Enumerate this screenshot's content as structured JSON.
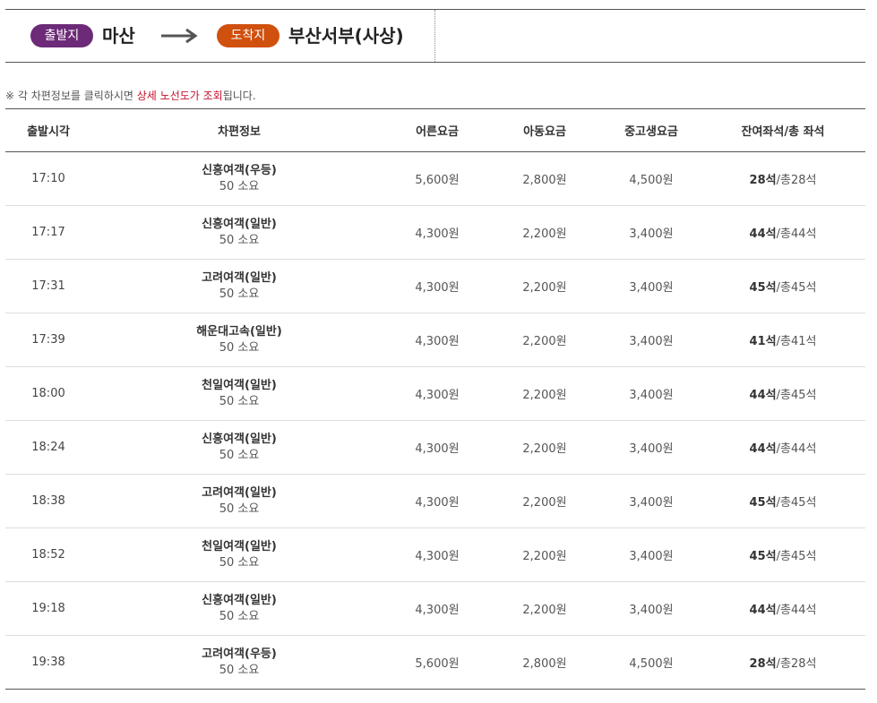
{
  "route": {
    "departure_badge": "출발지",
    "departure": "마산",
    "arrival_badge": "도착지",
    "arrival": "부산서부(사상)",
    "departure_color": "#6c2a78",
    "arrival_color": "#d0500e"
  },
  "notice": {
    "prefix": "※ 각 차편정보를 클릭하시면 ",
    "highlight": "상세 노선도가 조회",
    "suffix": "됩니다."
  },
  "table": {
    "headers": {
      "time": "출발시각",
      "info": "차편정보",
      "adult": "어른요금",
      "child": "아동요금",
      "teen": "중고생요금",
      "seats": "잔여좌석/총 좌석"
    },
    "rows": [
      {
        "time": "17:10",
        "company": "신흥여객(우등)",
        "sub": "50 소요",
        "adult": "5,600원",
        "child": "2,800원",
        "teen": "4,500원",
        "seat_left": "28석",
        "seat_total": "/총28석"
      },
      {
        "time": "17:17",
        "company": "신흥여객(일반)",
        "sub": "50 소요",
        "adult": "4,300원",
        "child": "2,200원",
        "teen": "3,400원",
        "seat_left": "44석",
        "seat_total": "/총44석"
      },
      {
        "time": "17:31",
        "company": "고려여객(일반)",
        "sub": "50 소요",
        "adult": "4,300원",
        "child": "2,200원",
        "teen": "3,400원",
        "seat_left": "45석",
        "seat_total": "/총45석"
      },
      {
        "time": "17:39",
        "company": "해운대고속(일반)",
        "sub": "50 소요",
        "adult": "4,300원",
        "child": "2,200원",
        "teen": "3,400원",
        "seat_left": "41석",
        "seat_total": "/총41석"
      },
      {
        "time": "18:00",
        "company": "천일여객(일반)",
        "sub": "50 소요",
        "adult": "4,300원",
        "child": "2,200원",
        "teen": "3,400원",
        "seat_left": "44석",
        "seat_total": "/총45석"
      },
      {
        "time": "18:24",
        "company": "신흥여객(일반)",
        "sub": "50 소요",
        "adult": "4,300원",
        "child": "2,200원",
        "teen": "3,400원",
        "seat_left": "44석",
        "seat_total": "/총44석"
      },
      {
        "time": "18:38",
        "company": "고려여객(일반)",
        "sub": "50 소요",
        "adult": "4,300원",
        "child": "2,200원",
        "teen": "3,400원",
        "seat_left": "45석",
        "seat_total": "/총45석"
      },
      {
        "time": "18:52",
        "company": "천일여객(일반)",
        "sub": "50 소요",
        "adult": "4,300원",
        "child": "2,200원",
        "teen": "3,400원",
        "seat_left": "45석",
        "seat_total": "/총45석"
      },
      {
        "time": "19:18",
        "company": "신흥여객(일반)",
        "sub": "50 소요",
        "adult": "4,300원",
        "child": "2,200원",
        "teen": "3,400원",
        "seat_left": "44석",
        "seat_total": "/총44석"
      },
      {
        "time": "19:38",
        "company": "고려여객(우등)",
        "sub": "50 소요",
        "adult": "5,600원",
        "child": "2,800원",
        "teen": "4,500원",
        "seat_left": "28석",
        "seat_total": "/총28석"
      }
    ]
  }
}
